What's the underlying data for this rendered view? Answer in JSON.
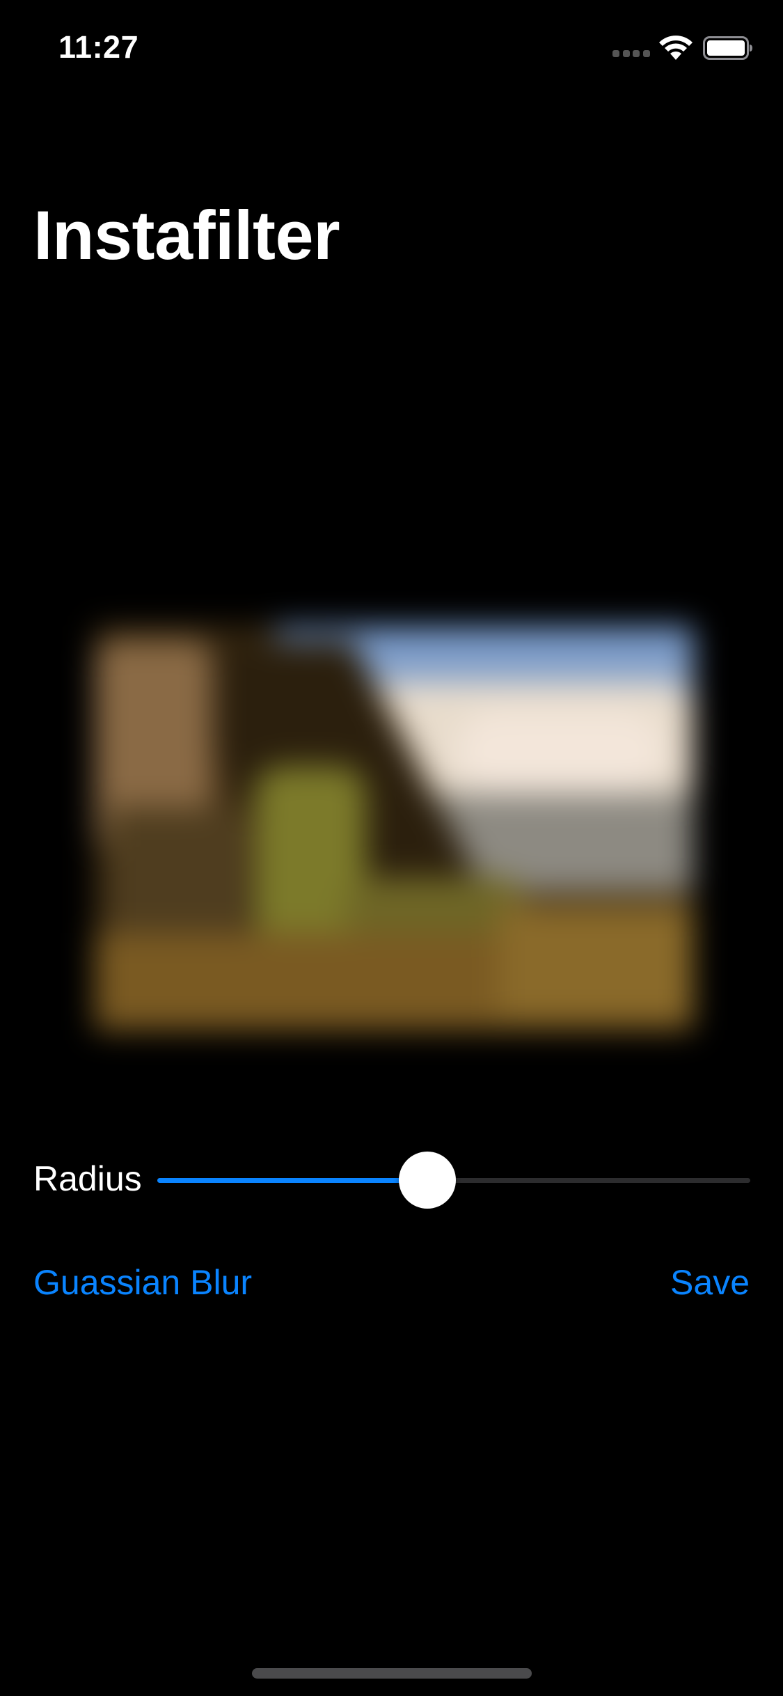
{
  "status_bar": {
    "time": "11:27"
  },
  "header": {
    "title": "Instafilter"
  },
  "image": {
    "filter_applied": "Gaussian blur"
  },
  "controls": {
    "slider_label": "Radius",
    "slider_value": 0.45
  },
  "actions": {
    "filter_button_label": "Guassian Blur",
    "save_button_label": "Save"
  },
  "colors": {
    "accent": "#0a84ff",
    "background": "#000000"
  }
}
